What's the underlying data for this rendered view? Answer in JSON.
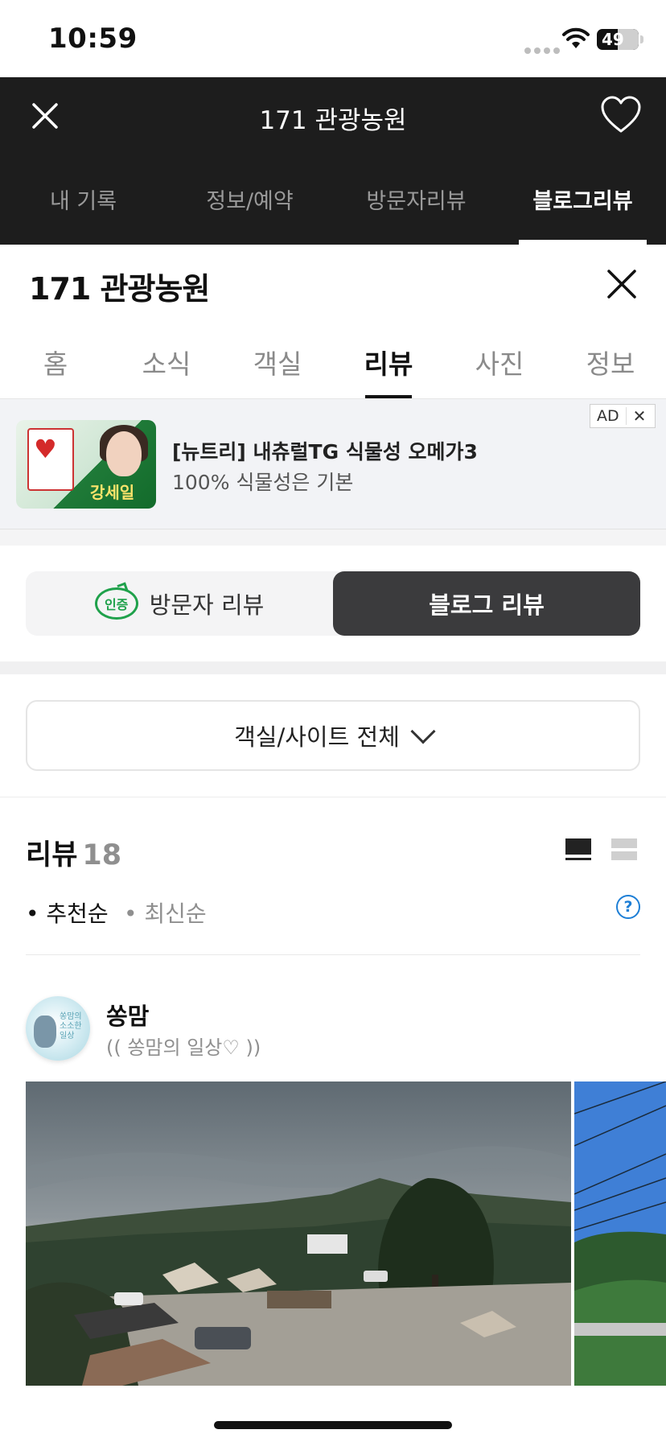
{
  "status_bar": {
    "time": "10:59",
    "battery": "49"
  },
  "top_bar": {
    "title": "171 관광농원",
    "tabs": [
      {
        "label": "내 기록",
        "active": false
      },
      {
        "label": "정보/예약",
        "active": false
      },
      {
        "label": "방문자리뷰",
        "active": false
      },
      {
        "label": "블로그리뷰",
        "active": true
      }
    ]
  },
  "place": {
    "title": "171 관광농원",
    "tabs": [
      {
        "label": "홈",
        "active": false
      },
      {
        "label": "소식",
        "active": false
      },
      {
        "label": "객실",
        "active": false
      },
      {
        "label": "리뷰",
        "active": true
      },
      {
        "label": "사진",
        "active": false
      },
      {
        "label": "정보",
        "active": false
      }
    ]
  },
  "ad": {
    "title": "[뉴트리] 내츄럴TG 식물성 오메가3",
    "subtitle": "100% 식물성은 기본",
    "badge": "AD",
    "thumb_sale_text": "강세일"
  },
  "review_toggle": {
    "visitor_badge": "인증",
    "visitor_label": "방문자 리뷰",
    "blog_label": "블로그 리뷰",
    "selected": "blog"
  },
  "filter": {
    "label": "객실/사이트 전체"
  },
  "reviews": {
    "title": "리뷰",
    "count": "18",
    "sort_options": [
      "• 추천순",
      "• 최신순"
    ],
    "active_sort": "추천순",
    "help": "?"
  },
  "review_item": {
    "author": "쏭맘",
    "blog_name": "(( 쏭맘의 일상♡ ))",
    "avatar_text": "쏭맘의\n소소한\n일상"
  },
  "colors": {
    "header_bg": "#1d1d1d",
    "badge_green": "#1fa14b",
    "help_blue": "#1e7fd6",
    "segment_selected": "#3b3b3d"
  }
}
